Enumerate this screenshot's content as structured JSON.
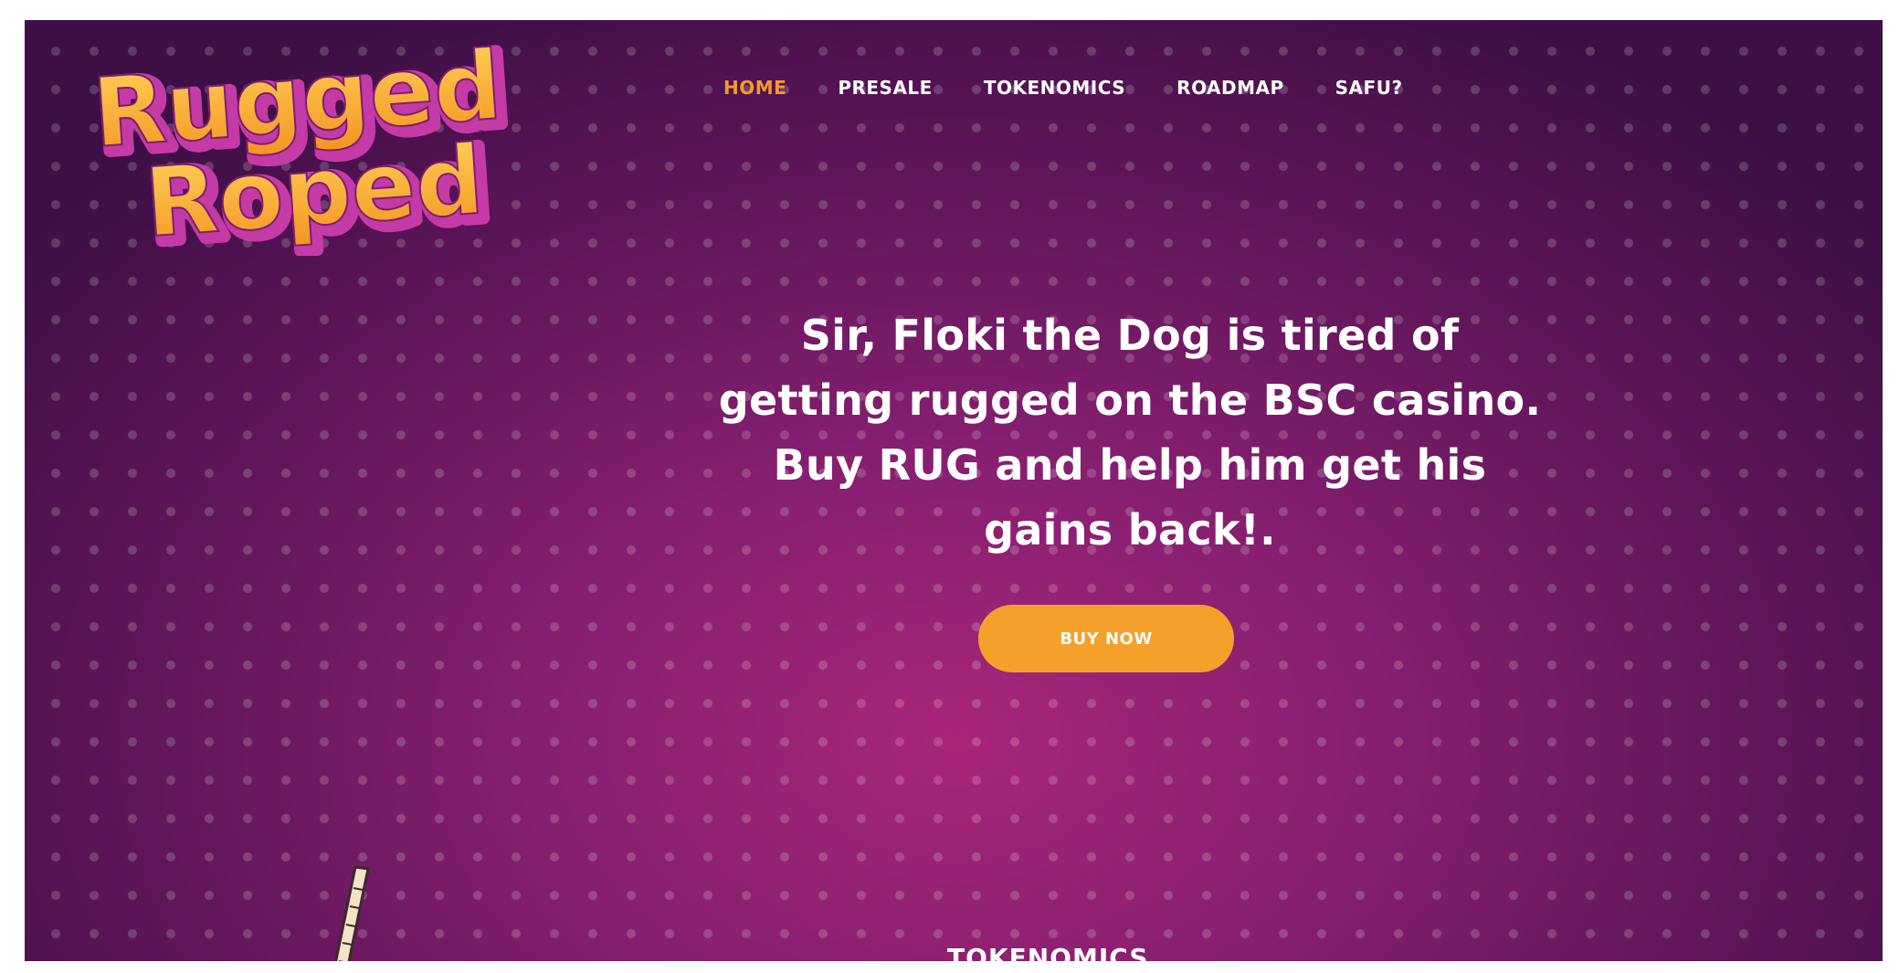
{
  "brand": {
    "logo_line1": "Rugged",
    "logo_line2": "Roped",
    "logo_fill_color": "#fbb43a",
    "logo_shadow_color": "#c63aa6"
  },
  "nav": {
    "items": [
      {
        "label": "HOME",
        "active": true
      },
      {
        "label": "PRESALE",
        "active": false
      },
      {
        "label": "TOKENOMICS",
        "active": false
      },
      {
        "label": "ROADMAP",
        "active": false
      },
      {
        "label": "SAFU?",
        "active": false
      }
    ],
    "active_color": "#f59a2a"
  },
  "hero": {
    "line1": "Sir, Floki the Dog is tired of",
    "line2": "getting rugged on the BSC casino.",
    "line3": "Buy RUG and help him get his",
    "line4": "gains back!.",
    "cta_label": "BUY NOW",
    "cta_color": "#f6a02c"
  },
  "next_section": {
    "heading": "TOKENOMICS"
  },
  "theme": {
    "background_center": "#a8257a",
    "background_edge": "#3d0f45"
  }
}
